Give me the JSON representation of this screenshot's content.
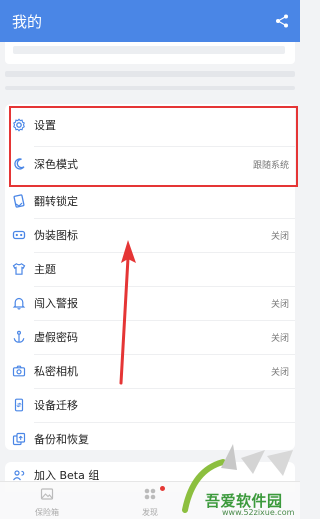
{
  "header": {
    "title": "我的",
    "share_icon": "share-icon"
  },
  "settings_list": [
    {
      "label": "设置",
      "value": "",
      "icon": "gear-icon"
    },
    {
      "label": "深色模式",
      "value": "跟随系统",
      "icon": "moon-icon"
    },
    {
      "label": "翻转锁定",
      "value": "",
      "icon": "flip-lock-icon"
    },
    {
      "label": "伪装图标",
      "value": "关闭",
      "icon": "mask-icon"
    },
    {
      "label": "主题",
      "value": "",
      "icon": "shirt-icon"
    },
    {
      "label": "闯入警报",
      "value": "关闭",
      "icon": "bell-icon"
    },
    {
      "label": "虚假密码",
      "value": "关闭",
      "icon": "anchor-icon"
    },
    {
      "label": "私密相机",
      "value": "关闭",
      "icon": "camera-icon"
    },
    {
      "label": "设备迁移",
      "value": "",
      "icon": "phone-transfer-icon"
    },
    {
      "label": "备份和恢复",
      "value": "",
      "icon": "backup-icon"
    }
  ],
  "beta_row": {
    "label": "加入 Beta 组"
  },
  "bottom_nav": [
    {
      "label": "保险箱",
      "icon": "photo-icon"
    },
    {
      "label": "发现",
      "icon": "grid-icon"
    }
  ],
  "watermark": {
    "text": "吾爱软件园",
    "url": "www.52zixue.com"
  },
  "colors": {
    "header": "#4a86e6",
    "highlight": "#e53535",
    "icon": "#4a86e6"
  }
}
